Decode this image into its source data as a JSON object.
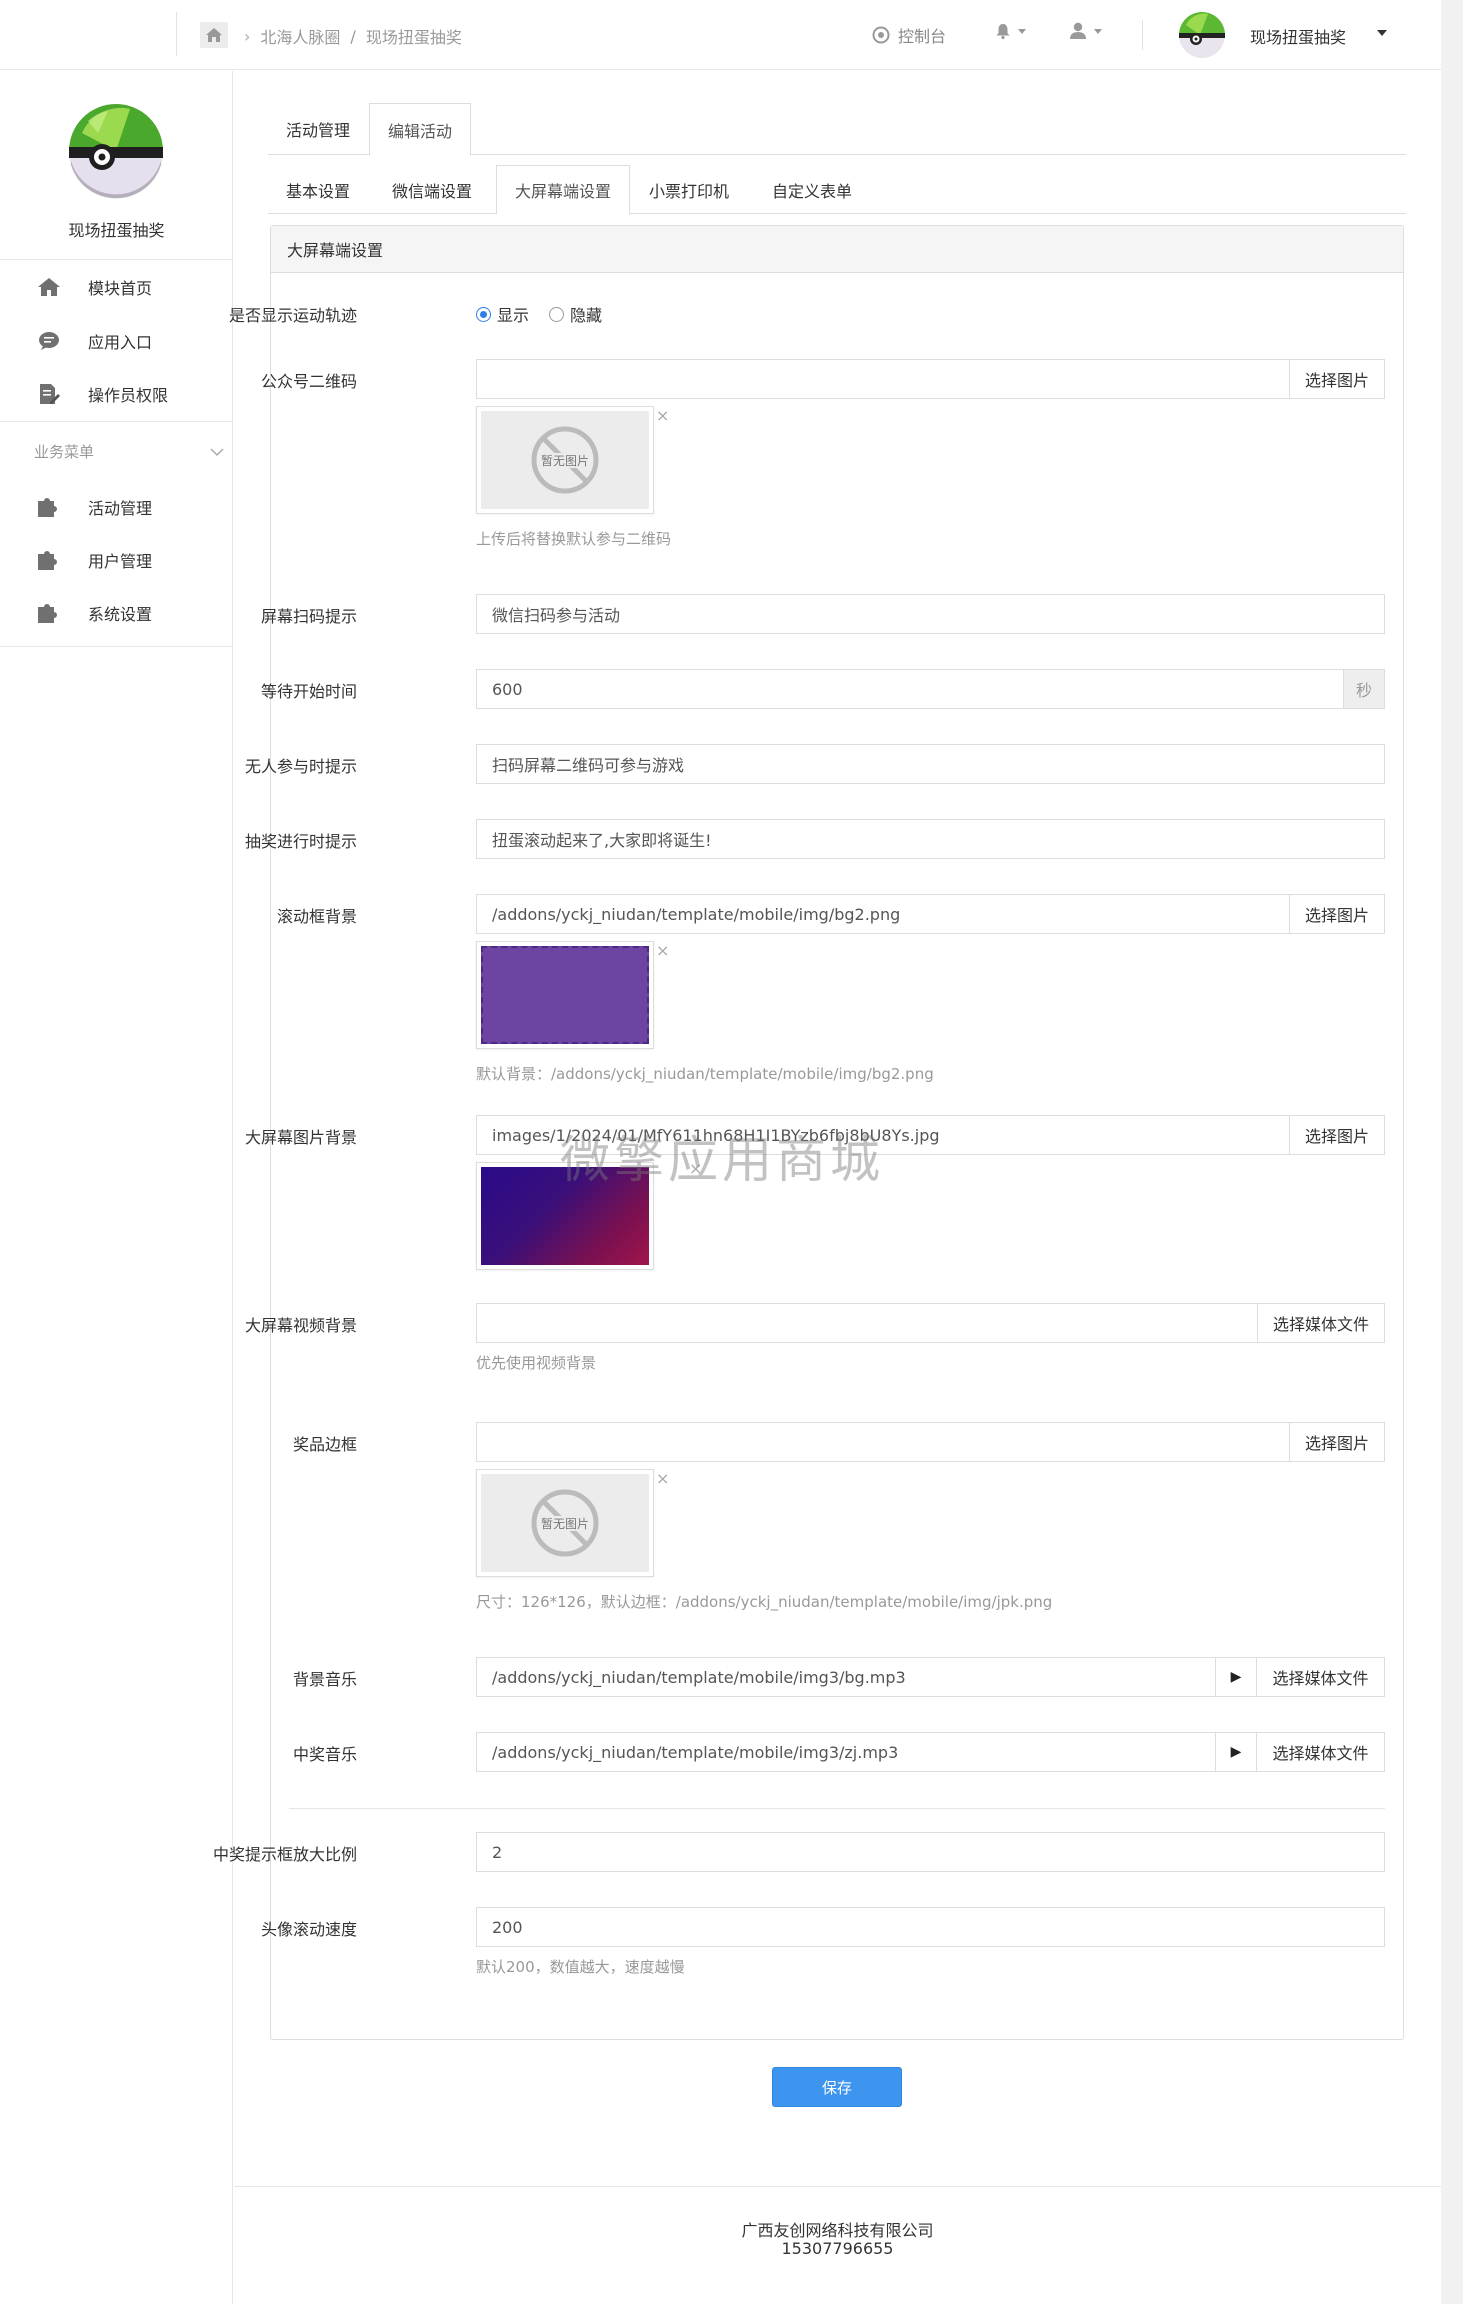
{
  "header": {
    "breadcrumb": [
      "北海人脉圈",
      "现场扭蛋抽奖"
    ],
    "breadcrumb_sep": "/",
    "console_label": "控制台",
    "app_name": "现场扭蛋抽奖"
  },
  "sidebar": {
    "app_name": "现场扭蛋抽奖",
    "top_items": [
      {
        "label": "模块首页",
        "icon": "home-icon"
      },
      {
        "label": "应用入口",
        "icon": "chat-bubble-icon"
      },
      {
        "label": "操作员权限",
        "icon": "edit-document-icon"
      }
    ],
    "group_label": "业务菜单",
    "group_items": [
      {
        "label": "活动管理",
        "icon": "puzzle-icon"
      },
      {
        "label": "用户管理",
        "icon": "puzzle-icon"
      },
      {
        "label": "系统设置",
        "icon": "puzzle-icon"
      }
    ]
  },
  "tabs_primary": [
    "活动管理",
    "编辑活动"
  ],
  "tabs_primary_active": "编辑活动",
  "tabs_secondary": [
    "基本设置",
    "微信端设置",
    "大屏幕端设置",
    "小票打印机",
    "自定义表单"
  ],
  "tabs_secondary_active": "大屏幕端设置",
  "panel": {
    "title": "大屏幕端设置",
    "show_track": {
      "label": "是否显示运动轨迹",
      "options": [
        "显示",
        "隐藏"
      ],
      "selected": "显示"
    },
    "qrcode": {
      "label": "公众号二维码",
      "value": "",
      "button": "选择图片",
      "placeholder_img": "暂无图片",
      "help": "上传后将替换默认参与二维码"
    },
    "scan_tip": {
      "label": "屏幕扫码提示",
      "value": "微信扫码参与活动"
    },
    "wait_time": {
      "label": "等待开始时间",
      "value": "600",
      "unit": "秒"
    },
    "no_one_tip": {
      "label": "无人参与时提示",
      "value": "扫码屏幕二维码可参与游戏"
    },
    "running_tip": {
      "label": "抽奖进行时提示",
      "value": "扭蛋滚动起来了,大家即将诞生!"
    },
    "scroll_bg": {
      "label": "滚动框背景",
      "value": "/addons/yckj_niudan/template/mobile/img/bg2.png",
      "button": "选择图片",
      "help": "默认背景：/addons/yckj_niudan/template/mobile/img/bg2.png",
      "color": "#6e44a3"
    },
    "screen_bg": {
      "label": "大屏幕图片背景",
      "value": "images/1/2024/01/MfY611hn68H1I1BYzb6fbj8bU8Ys.jpg",
      "button": "选择图片"
    },
    "video_bg": {
      "label": "大屏幕视频背景",
      "value": "",
      "button": "选择媒体文件",
      "help": "优先使用视频背景"
    },
    "prize_border": {
      "label": "奖品边框",
      "value": "",
      "button": "选择图片",
      "placeholder_img": "暂无图片",
      "help": "尺寸：126*126，默认边框：/addons/yckj_niudan/template/mobile/img/jpk.png"
    },
    "bg_music": {
      "label": "背景音乐",
      "value": "/addons/yckj_niudan/template/mobile/img3/bg.mp3",
      "button": "选择媒体文件"
    },
    "win_music": {
      "label": "中奖音乐",
      "value": "/addons/yckj_niudan/template/mobile/img3/zj.mp3",
      "button": "选择媒体文件"
    },
    "zoom_ratio": {
      "label": "中奖提示框放大比例",
      "value": "2"
    },
    "avatar_speed": {
      "label": "头像滚动速度",
      "value": "200",
      "help": "默认200，数值越大，速度越慢"
    },
    "remove_symbol": "×"
  },
  "save_button": "保存",
  "footer": {
    "company": "广西友创网络科技有限公司",
    "phone": "15307796655"
  },
  "watermark": "微擎应用商城",
  "colors": {
    "primary": "#3d95f0",
    "radio_on": "#2f7fe6"
  }
}
